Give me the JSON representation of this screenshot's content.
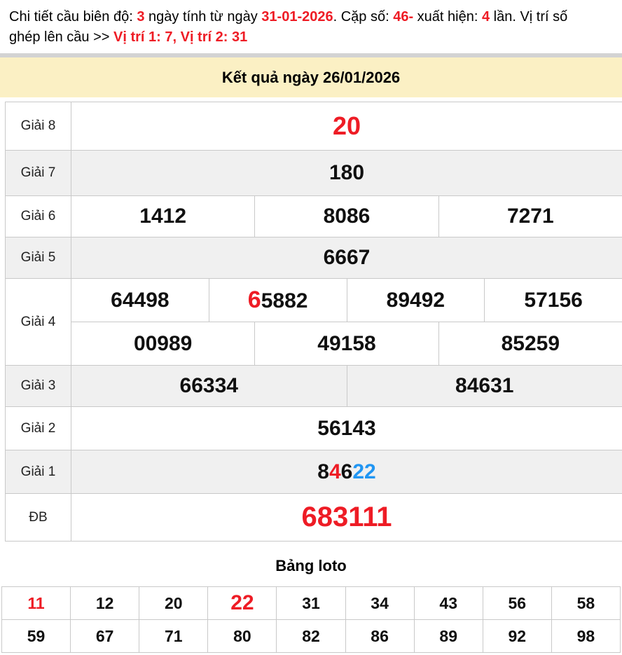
{
  "colors": {
    "red": "#ee1c25",
    "blue": "#2196f3",
    "banner_bg": "#fbf0c4",
    "row_alt_bg": "#f0f0f0",
    "border": "#c9c9c9",
    "divider": "#d3d3d3"
  },
  "header": {
    "segments": [
      {
        "t": "Chi tiết cầu biên độ: ",
        "c": "black"
      },
      {
        "t": "3",
        "c": "red"
      },
      {
        "t": " ngày tính từ ngày ",
        "c": "black"
      },
      {
        "t": "31-01-2026",
        "c": "red"
      },
      {
        "t": ". Cặp số: ",
        "c": "black"
      },
      {
        "t": "46-",
        "c": "red"
      },
      {
        "t": " xuất hiện: ",
        "c": "black"
      },
      {
        "t": "4",
        "c": "red"
      },
      {
        "t": " lần. Vị trí số",
        "c": "black"
      },
      {
        "br": true
      },
      {
        "t": "ghép lên cầu >> ",
        "c": "black"
      },
      {
        "t": "Vị trí 1: 7, Vị trí 2: 31",
        "c": "red"
      }
    ]
  },
  "banner": {
    "title": "Kết quả ngày 26/01/2026"
  },
  "results": {
    "rows": [
      {
        "label": "Giải 8",
        "subrows": [
          [
            [
              {
                "t": "20",
                "c": "red"
              }
            ]
          ]
        ]
      },
      {
        "label": "Giải 7",
        "subrows": [
          [
            [
              {
                "t": "180"
              }
            ]
          ]
        ]
      },
      {
        "label": "Giải 6",
        "subrows": [
          [
            [
              {
                "t": "1412"
              }
            ],
            [
              {
                "t": "8086"
              }
            ],
            [
              {
                "t": "7271"
              }
            ]
          ]
        ]
      },
      {
        "label": "Giải 5",
        "subrows": [
          [
            [
              {
                "t": "6667"
              }
            ]
          ]
        ]
      },
      {
        "label": "Giải 4",
        "subrows": [
          [
            [
              {
                "t": "64498"
              }
            ],
            [
              {
                "t": "6",
                "c": "red",
                "size": "md"
              },
              {
                "t": "5882"
              }
            ],
            [
              {
                "t": "89492"
              }
            ],
            [
              {
                "t": "57156"
              }
            ]
          ],
          [
            [
              {
                "t": "00989"
              }
            ],
            [
              {
                "t": "49158"
              }
            ],
            [
              {
                "t": "85259"
              }
            ]
          ]
        ]
      },
      {
        "label": "Giải 3",
        "subrows": [
          [
            [
              {
                "t": "66334"
              }
            ],
            [
              {
                "t": "84631"
              }
            ]
          ]
        ]
      },
      {
        "label": "Giải 2",
        "subrows": [
          [
            [
              {
                "t": "56143"
              }
            ]
          ]
        ]
      },
      {
        "label": "Giải 1",
        "subrows": [
          [
            [
              {
                "t": "8"
              },
              {
                "t": "4",
                "c": "red"
              },
              {
                "t": "6"
              },
              {
                "t": "22",
                "c": "blue"
              }
            ]
          ]
        ]
      },
      {
        "label": "ĐB",
        "subrows": [
          [
            [
              {
                "t": "683111",
                "c": "red"
              }
            ]
          ]
        ]
      }
    ]
  },
  "loto": {
    "title": "Bảng loto",
    "rows": [
      [
        {
          "t": "11",
          "c": "red"
        },
        {
          "t": "12"
        },
        {
          "t": "20"
        },
        {
          "t": "22",
          "c": "red",
          "size": "lg"
        },
        {
          "t": "31"
        },
        {
          "t": "34"
        },
        {
          "t": "43"
        },
        {
          "t": "56"
        },
        {
          "t": "58"
        }
      ],
      [
        {
          "t": "59"
        },
        {
          "t": "67"
        },
        {
          "t": "71"
        },
        {
          "t": "80"
        },
        {
          "t": "82"
        },
        {
          "t": "86"
        },
        {
          "t": "89"
        },
        {
          "t": "92"
        },
        {
          "t": "98"
        }
      ]
    ]
  }
}
